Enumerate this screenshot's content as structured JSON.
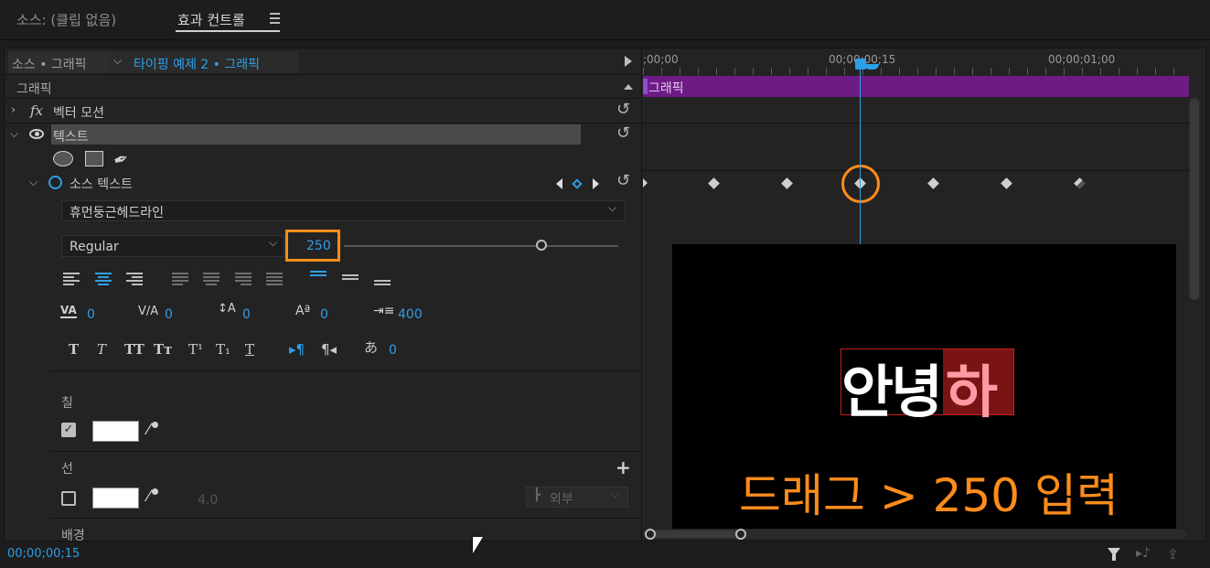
{
  "tabs": {
    "source": "소스: (클립 없음)",
    "effect_controls": "효과 컨트롤",
    "menu_icon": "hamburger-icon"
  },
  "header": {
    "source_label": "소스 • 그래픽",
    "sequence_label": "타이핑 예제 2 • 그래픽"
  },
  "timeline": {
    "tc_start": ";00;00",
    "tc_mid": "00;00;00;15",
    "tc_end": "00;00;01;00",
    "clip_label": "그래픽",
    "clip_color": "#6e1b86",
    "playhead_color": "#2d9fe6"
  },
  "graphics": {
    "section_label": "그래픽",
    "vector_motion": "벡터 모션",
    "text_layer": "텍스트",
    "source_text": "소스 텍스트",
    "font_family": "휴먼둥근헤드라인",
    "font_style": "Regular",
    "font_size": "250",
    "font_size_slider": 0.72,
    "tracking": "0",
    "kerning": "0",
    "leading": "0",
    "baseline": "0",
    "tab_width": "400",
    "tsume": "0"
  },
  "appearance": {
    "fill_label": "칠",
    "stroke_label": "선",
    "stroke_width": "4.0",
    "stroke_position": "외부",
    "background_label": "배경",
    "fill_color": "#ffffff",
    "stroke_color": "#ffffff"
  },
  "preview": {
    "text_white": "안녕",
    "text_pink": "하",
    "annotation": "드래그 > 250 입력",
    "annotation_color": "#ff8c1a"
  },
  "footer": {
    "timecode": "00;00;00;15"
  }
}
